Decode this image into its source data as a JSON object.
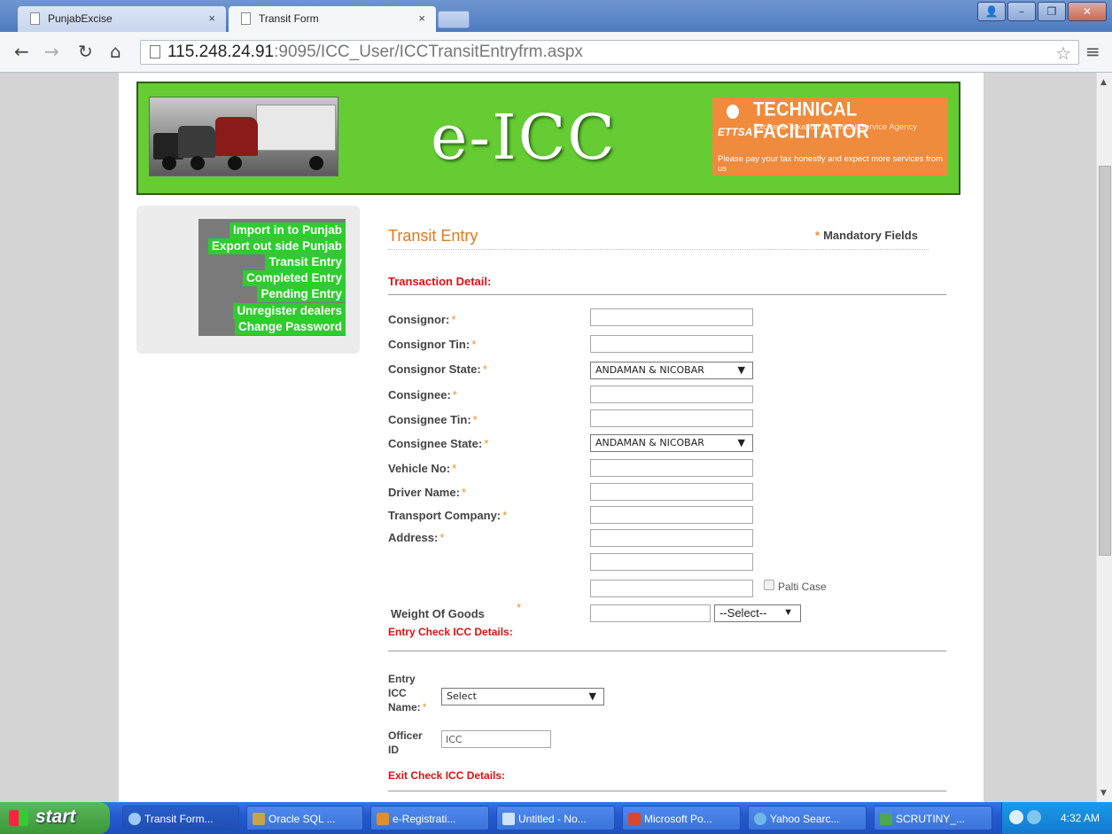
{
  "browser": {
    "tabs": [
      {
        "label": "PunjabExcise",
        "active": false
      },
      {
        "label": "Transit Form",
        "active": true
      }
    ],
    "tab_close_glyph": "×",
    "url_host": "115.248.24.91",
    "url_path": ":9095/ICC_User/ICCTransitEntryfrm.aspx"
  },
  "banner": {
    "brand": "e-ICC",
    "facilitator_logo": "ETTSA",
    "facilitator_title": "TECHNICAL FACILITATOR",
    "facilitator_subtitle": "Excise & Taxation Technical Service Agency",
    "facilitator_tagline": "Please pay your tax honestly and expect more services from us"
  },
  "menu": {
    "items": [
      "Import in to Punjab",
      "Export out side Punjab",
      "Transit Entry",
      "Completed Entry",
      "Pending Entry",
      "Unregister dealers",
      "Change Password"
    ]
  },
  "form": {
    "title": "Transit Entry",
    "mandatory_marker": "*",
    "mandatory_text": "Mandatory Fields",
    "sections": {
      "transaction": "Transaction Detail:",
      "entry_check": "Entry Check ICC Details:",
      "exit_check": "Exit Check ICC Details:"
    },
    "fields": {
      "consignor": {
        "label": "Consignor:",
        "value": ""
      },
      "consignor_tin": {
        "label": "Consignor Tin:",
        "value": ""
      },
      "consignor_state": {
        "label": "Consignor State:",
        "value": "ANDAMAN & NICOBAR"
      },
      "consignee": {
        "label": "Consignee:",
        "value": ""
      },
      "consignee_tin": {
        "label": "Consignee Tin:",
        "value": ""
      },
      "consignee_state": {
        "label": "Consignee State:",
        "value": "ANDAMAN & NICOBAR"
      },
      "vehicle_no": {
        "label": "Vehicle No:",
        "value": ""
      },
      "driver_name": {
        "label": "Driver Name:",
        "value": ""
      },
      "transport_company": {
        "label": "Transport Company:",
        "value": ""
      },
      "address": {
        "label": "Address:",
        "value": ""
      },
      "palti_case": {
        "label": "Palti Case",
        "checked": false
      },
      "weight_of_goods": {
        "label": "Weight Of Goods",
        "value": "",
        "unit": "--Select--"
      },
      "entry_icc_name": {
        "label_lines": [
          "Entry",
          "ICC",
          "Name:"
        ],
        "value": "Select"
      },
      "officer_id": {
        "label_lines": [
          "Officer",
          "ID"
        ],
        "value": "ICC"
      }
    }
  },
  "taskbar": {
    "start": "start",
    "items": [
      "Transit Form...",
      "Oracle SQL ...",
      "e-Registrati...",
      "Untitled - No...",
      "Microsoft Po...",
      "Yahoo Searc...",
      "SCRUTINY_..."
    ],
    "clock": "4:32 AM"
  },
  "colors": {
    "banner_green": "#66cc33",
    "menu_green": "#2ecc2e",
    "title_orange": "#e2791a",
    "section_red": "#e01010",
    "required_orange": "#f28c2a"
  }
}
